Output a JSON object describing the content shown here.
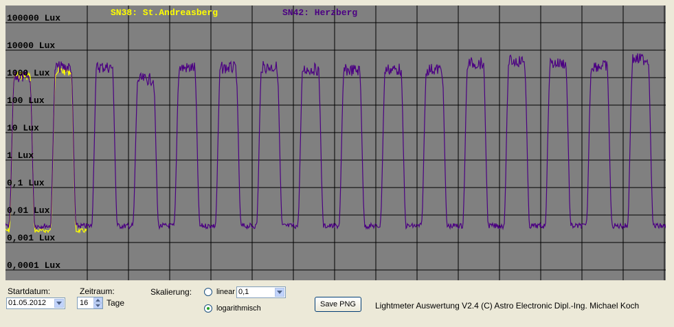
{
  "legend": {
    "series1": "SN38: St.Andreasberg",
    "series2": "SN42: Herzberg",
    "color1": "#ffff00",
    "color2": "#4b0082"
  },
  "plot": {
    "background": "#808080",
    "y_ticks": [
      "100000 Lux",
      "10000 Lux",
      "1000 Lux",
      "100 Lux",
      "10 Lux",
      "1 Lux",
      "0,1 Lux",
      "0,01 Lux",
      "0,001 Lux",
      "0,0001 Lux"
    ]
  },
  "chart_data": {
    "type": "line",
    "y_scale": "log",
    "ylim": [
      0.0001,
      100000
    ],
    "x_days": 16,
    "grid": true,
    "series": [
      {
        "name": "SN38: St.Andreasberg",
        "color": "#ffff00",
        "day_peaks": [
          900,
          1300
        ],
        "night_level": 0.002
      },
      {
        "name": "SN42: Herzberg",
        "color": "#4b0082",
        "day_peaks": [
          800,
          1800,
          1800,
          650,
          1700,
          1700,
          1800,
          1500,
          1400,
          1500,
          1500,
          2500,
          3000,
          2500,
          2000,
          3500,
          4000
        ],
        "night_level": 0.003
      }
    ]
  },
  "controls": {
    "startdatum_label": "Startdatum:",
    "startdatum_value": "01.05.2012",
    "zeitraum_label": "Zeitraum:",
    "zeitraum_value": "16",
    "zeitraum_unit": "Tage",
    "skalierung_label": "Skalierung:",
    "linear_label": "linear",
    "linear_value": "0,1",
    "log_label": "logarithmisch",
    "save_label": "Save PNG",
    "credits": "Lightmeter Auswertung V2.4  (C) Astro Electronic Dipl.-Ing. Michael Koch"
  }
}
